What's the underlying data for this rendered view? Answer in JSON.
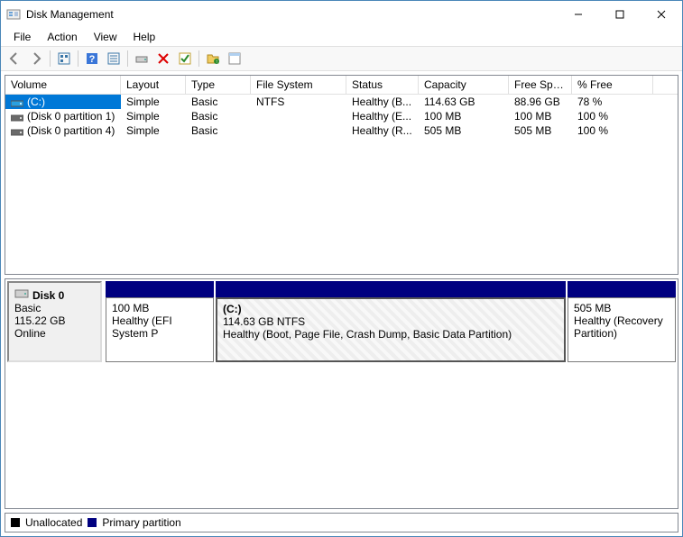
{
  "window": {
    "title": "Disk Management"
  },
  "menu": {
    "items": [
      "File",
      "Action",
      "View",
      "Help"
    ]
  },
  "columns": {
    "volume": "Volume",
    "layout": "Layout",
    "type": "Type",
    "fs": "File System",
    "status": "Status",
    "capacity": "Capacity",
    "free": "Free Spa...",
    "pfree": "% Free"
  },
  "volumes": [
    {
      "name": "(C:)",
      "layout": "Simple",
      "type": "Basic",
      "fs": "NTFS",
      "status": "Healthy (B...",
      "capacity": "114.63 GB",
      "free": "88.96 GB",
      "pfree": "78 %",
      "selected": true,
      "iconColor": "#2aa0e0"
    },
    {
      "name": "(Disk 0 partition 1)",
      "layout": "Simple",
      "type": "Basic",
      "fs": "",
      "status": "Healthy (E...",
      "capacity": "100 MB",
      "free": "100 MB",
      "pfree": "100 %",
      "selected": false,
      "iconColor": "#6a6a6a"
    },
    {
      "name": "(Disk 0 partition 4)",
      "layout": "Simple",
      "type": "Basic",
      "fs": "",
      "status": "Healthy (R...",
      "capacity": "505 MB",
      "free": "505 MB",
      "pfree": "100 %",
      "selected": false,
      "iconColor": "#6a6a6a"
    }
  ],
  "disk": {
    "name": "Disk 0",
    "type": "Basic",
    "size": "115.22 GB",
    "state": "Online"
  },
  "partitions": [
    {
      "title": "",
      "line2": "100 MB",
      "line3": "Healthy (EFI System P",
      "widthPx": 120,
      "selected": false
    },
    {
      "title": "(C:)",
      "line2": "114.63 GB NTFS",
      "line3": "Healthy (Boot, Page File, Crash Dump, Basic Data Partition)",
      "widthPx": 388,
      "selected": true
    },
    {
      "title": "",
      "line2": "505 MB",
      "line3": "Healthy (Recovery Partition)",
      "widthPx": 120,
      "selected": false
    }
  ],
  "legend": {
    "unallocated": {
      "label": "Unallocated",
      "color": "#000000"
    },
    "primary": {
      "label": "Primary partition",
      "color": "#000080"
    }
  }
}
